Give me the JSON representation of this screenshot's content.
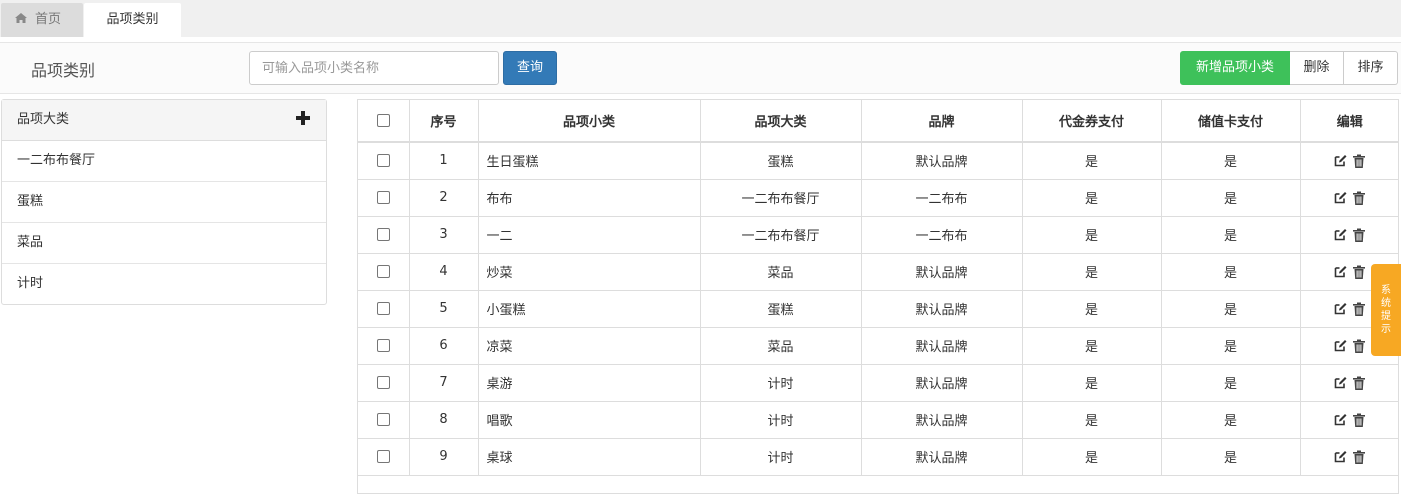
{
  "tabs": {
    "home_label": "首页",
    "active_label": "品项类别"
  },
  "toolbar": {
    "title": "品项类别",
    "search_placeholder": "可输入品项小类名称",
    "query_label": "查询",
    "add_label": "新增品项小类",
    "delete_label": "删除",
    "sort_label": "排序"
  },
  "sidebar": {
    "header": "品项大类",
    "items": [
      "一二布布餐厅",
      "蛋糕",
      "菜品",
      "计时"
    ]
  },
  "table": {
    "headers": [
      "序号",
      "品项小类",
      "品项大类",
      "品牌",
      "代金券支付",
      "储值卡支付",
      "编辑"
    ],
    "rows": [
      {
        "no": "1",
        "sub": "生日蛋糕",
        "cat": "蛋糕",
        "brand": "默认品牌",
        "voucher": "是",
        "card": "是"
      },
      {
        "no": "2",
        "sub": "布布",
        "cat": "一二布布餐厅",
        "brand": "一二布布",
        "voucher": "是",
        "card": "是"
      },
      {
        "no": "3",
        "sub": "一二",
        "cat": "一二布布餐厅",
        "brand": "一二布布",
        "voucher": "是",
        "card": "是"
      },
      {
        "no": "4",
        "sub": "炒菜",
        "cat": "菜品",
        "brand": "默认品牌",
        "voucher": "是",
        "card": "是"
      },
      {
        "no": "5",
        "sub": "小蛋糕",
        "cat": "蛋糕",
        "brand": "默认品牌",
        "voucher": "是",
        "card": "是"
      },
      {
        "no": "6",
        "sub": "凉菜",
        "cat": "菜品",
        "brand": "默认品牌",
        "voucher": "是",
        "card": "是"
      },
      {
        "no": "7",
        "sub": "桌游",
        "cat": "计时",
        "brand": "默认品牌",
        "voucher": "是",
        "card": "是"
      },
      {
        "no": "8",
        "sub": "唱歌",
        "cat": "计时",
        "brand": "默认品牌",
        "voucher": "是",
        "card": "是"
      },
      {
        "no": "9",
        "sub": "桌球",
        "cat": "计时",
        "brand": "默认品牌",
        "voucher": "是",
        "card": "是"
      }
    ]
  },
  "system_tip": [
    "系",
    "统",
    "提",
    "示"
  ],
  "colors": {
    "primary": "#337ab7",
    "success": "#3ec15a",
    "warning": "#f7a823"
  }
}
